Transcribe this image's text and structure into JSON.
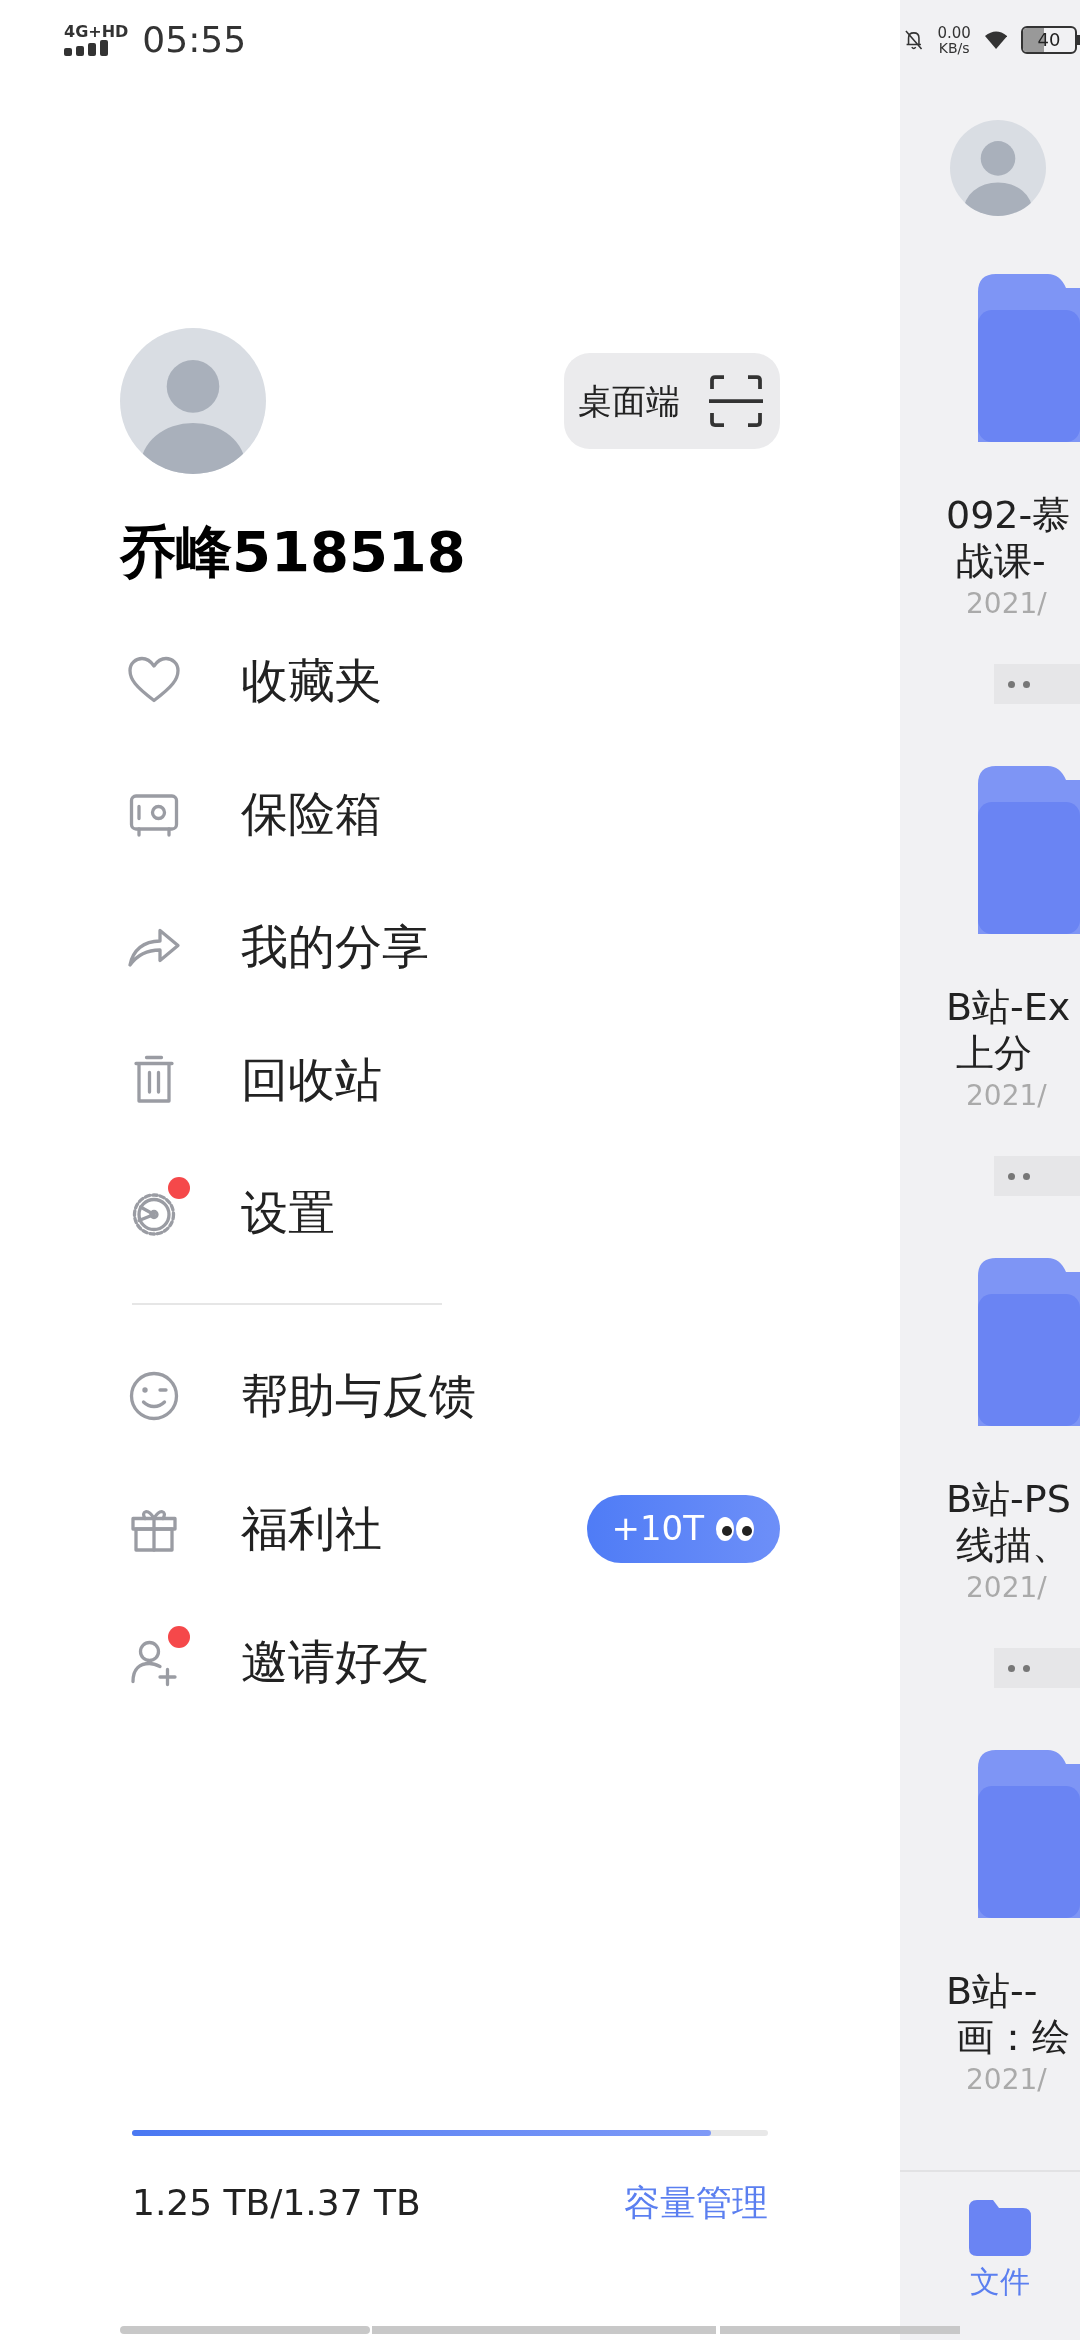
{
  "status_bar": {
    "network": "4G+HD",
    "time": "05:55",
    "speed_value": "0.00",
    "speed_unit": "KB/s",
    "battery": "40"
  },
  "profile": {
    "desktop_button": "桌面端",
    "username": "乔峰518518"
  },
  "menu_items": [
    {
      "label": "收藏夹",
      "dot": false
    },
    {
      "label": "保险箱",
      "dot": false
    },
    {
      "label": "我的分享",
      "dot": false
    },
    {
      "label": "回收站",
      "dot": false
    },
    {
      "label": "设置",
      "dot": true
    }
  ],
  "more_items": [
    {
      "label": "帮助与反馈",
      "dot": false
    },
    {
      "label": "福利社",
      "dot": false,
      "badge": "+10T"
    },
    {
      "label": "邀请好友",
      "dot": true
    }
  ],
  "storage": {
    "level": 0.91,
    "usage": "1.25 TB/1.37 TB",
    "manage_link": "容量管理"
  },
  "background_panel": {
    "folders": [
      {
        "title_lines": [
          "092-慕",
          "战课-"
        ],
        "date": "2021/"
      },
      {
        "title_lines": [
          "B站-Ex",
          "上分"
        ],
        "date": "2021/"
      },
      {
        "title_lines": [
          "B站-PS",
          "线描、"
        ],
        "date": "2021/"
      },
      {
        "title_lines": [
          "B站--",
          "画：绘"
        ],
        "date": "2021/"
      }
    ],
    "tab": {
      "label": "文件",
      "selected": true
    }
  }
}
